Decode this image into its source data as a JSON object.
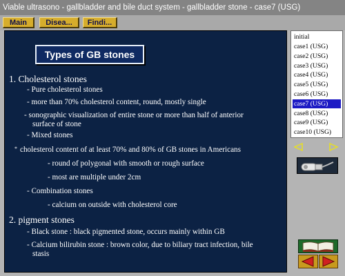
{
  "window": {
    "title": "Viable ultrasono - gallbladder and bile duct system - gallbladder stone - case7 (USG)"
  },
  "toolbar": {
    "main_label": "Main",
    "disease_label": "Disea...",
    "findings_label": "Findi..."
  },
  "content": {
    "heading": "Types of GB stones",
    "section1": {
      "title": "1. Cholesterol stones",
      "l1": "- Pure cholesterol stones",
      "l2": "- more than 70% cholesterol content, round, mostly single",
      "l3a": "- sonographic visualization of entire stone or more than half of anterior",
      "l3b": "surface of stone",
      "l4": "- Mixed stones",
      "bullet": "*",
      "l5": "cholesterol content of at least 70% and 80% of GB stones in Americans",
      "l6": "- round of polygonal with smooth or rough surface",
      "l7": "- most are multiple under 2cm",
      "l8": "- Combination stones",
      "l9": "- calcium on outside with cholesterol core"
    },
    "section2": {
      "title": "2. pigment stones",
      "l1": "- Black stone : black pigmented stone, occurs mainly within GB",
      "l2a": "- Calcium bilirubin stone : brown color, due to biliary tract infection, bile",
      "l2b": "stasis"
    }
  },
  "sidebar": {
    "cases": [
      "initial",
      "case1 (USG)",
      "case2 (USG)",
      "case3 (USG)",
      "case4 (USG)",
      "case5 (USG)",
      "case6 (USG)",
      "case7 (USG)",
      "case8 (USG)",
      "case9 (USG)",
      "case10 (USG)"
    ],
    "selected": "case7 (USG)"
  },
  "colors": {
    "content_bg": "#0c2244",
    "button_gold": "#d6ad2c",
    "arrow_yellow": "#e8e020",
    "arrow_red": "#d02020",
    "selection": "#1c1ac4"
  }
}
